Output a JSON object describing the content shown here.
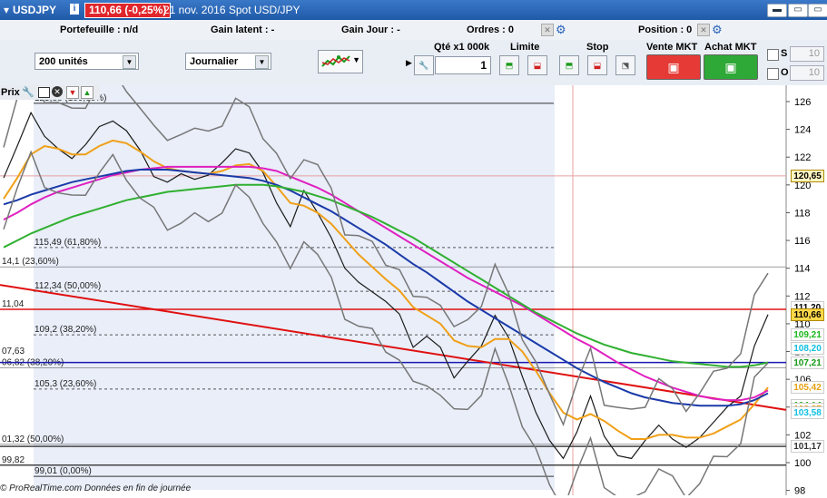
{
  "title_bar": {
    "symbol": "USDJPY",
    "info_icon": "i",
    "price_change": "110,66 (-0,25%)",
    "date_desc": "21 nov. 2016 Spot USD/JPY"
  },
  "info_bar": {
    "portefeuille": "Portefeuille : n/d",
    "gain_latent": "Gain latent : -",
    "gain_jour": "Gain Jour : -",
    "ordres": "Ordres : 0",
    "position": "Position : 0"
  },
  "toolbar": {
    "units_select": "200 unités",
    "period_select": "Journalier",
    "qty_label": "Qté x1 000k",
    "qty_value": "1",
    "limite_label": "Limite",
    "stop_label": "Stop",
    "vente_label": "Vente MKT",
    "achat_label": "Achat MKT",
    "box1": "10",
    "box2": "10"
  },
  "chart_toolbar": {
    "label": "Prix"
  },
  "chart_data": {
    "type": "line",
    "title": "USDJPY",
    "y_axis_ticks": [
      "126",
      "124",
      "122",
      "120",
      "118",
      "116",
      "114",
      "112",
      "110",
      "108",
      "106",
      "104",
      "102",
      "100",
      "98"
    ],
    "ylim": [
      98,
      127
    ],
    "price_tags": [
      {
        "value": "120,65",
        "bg": "#fff6c2",
        "fg": "#000"
      },
      {
        "value": "111,20",
        "bg": "#ffffff",
        "fg": "#000"
      },
      {
        "value": "110,66",
        "bg": "#ffd84a",
        "fg": "#000"
      },
      {
        "value": "109,21",
        "bg": "#ffffff",
        "fg": "#18b818"
      },
      {
        "value": "108,20",
        "bg": "#ffffff",
        "fg": "#10c0e0"
      },
      {
        "value": "107,21",
        "bg": "#ffffff",
        "fg": "#149a14"
      },
      {
        "value": "105,42",
        "bg": "#ffffff",
        "fg": "#e6a010"
      },
      {
        "value": "104,14",
        "bg": "#ffffff",
        "fg": "#18b818"
      },
      {
        "value": "103,87",
        "bg": "#ffffff",
        "fg": "#e6a010"
      },
      {
        "value": "103,58",
        "bg": "#ffffff",
        "fg": "#10c0e0"
      },
      {
        "value": "101,17",
        "bg": "#ffffff",
        "fg": "#333333"
      }
    ],
    "fibonacci_levels_left": [
      {
        "label": "125,88 (100,00%)",
        "price": 125.88
      },
      {
        "label": "115,49 (61,80%)",
        "price": 115.49
      },
      {
        "label": "112,34 (50,00%)",
        "price": 112.34
      },
      {
        "label": "109,2 (38,20%)",
        "price": 109.2
      },
      {
        "label": "105,3 (23,60%)",
        "price": 105.3
      },
      {
        "label": "99,01 (0,00%)",
        "price": 99.01
      }
    ],
    "fibonacci_levels_edge": [
      {
        "label": "14,1 (23,60%)",
        "price": 114.1
      },
      {
        "label": "06,82 (38,20%)",
        "price": 106.82
      },
      {
        "label": "01,32 (50,00%)",
        "price": 101.32
      }
    ],
    "edge_labels": [
      {
        "label": "11,04",
        "price": 111.04
      },
      {
        "label": "07,63",
        "price": 107.63
      },
      {
        "label": "99,82",
        "price": 99.82
      }
    ],
    "horizontal_lines": [
      {
        "price": 111.04,
        "color": "#e01010"
      },
      {
        "price": 107.21,
        "color": "#1a1ab0"
      },
      {
        "price": 101.17,
        "color": "#444444"
      },
      {
        "price": 99.82,
        "color": "#444444"
      }
    ],
    "trendline": {
      "from": 112.8,
      "to": 103.8,
      "color": "#e01010"
    },
    "series": [
      {
        "name": "price",
        "color": "#1b1b1b",
        "values": [
          120.5,
          122.8,
          125.2,
          123.5,
          122.6,
          121.9,
          122.9,
          124.2,
          124.6,
          123.9,
          122.5,
          120.6,
          120.2,
          120.8,
          120.4,
          120.7,
          121.6,
          122.6,
          122.3,
          120.9,
          118.7,
          117.0,
          119.6,
          118.0,
          116.2,
          114.0,
          113.0,
          112.3,
          111.6,
          110.7,
          108.3,
          109.1,
          108.3,
          106.1,
          107.3,
          108.4,
          110.6,
          109.0,
          106.2,
          103.6,
          101.6,
          100.3,
          102.2,
          104.8,
          101.9,
          100.5,
          100.3,
          101.6,
          102.7,
          101.7,
          101.1,
          101.8,
          102.9,
          104.0,
          104.8,
          108.4,
          110.66
        ]
      },
      {
        "name": "ma-orange",
        "color": "#f0a018",
        "values": [
          119.0,
          120.5,
          122.2,
          122.8,
          122.6,
          122.2,
          122.2,
          122.8,
          123.2,
          123.0,
          122.4,
          121.7,
          121.2,
          121.0,
          120.9,
          120.8,
          121.0,
          121.4,
          121.5,
          121.0,
          119.9,
          118.7,
          118.5,
          118.0,
          117.2,
          116.1,
          115.0,
          114.1,
          113.2,
          112.4,
          111.2,
          110.6,
          110.0,
          108.8,
          108.4,
          108.3,
          108.9,
          108.9,
          108.0,
          106.6,
          105.0,
          103.6,
          103.1,
          103.5,
          103.0,
          102.3,
          101.7,
          101.7,
          102.0,
          102.0,
          101.8,
          101.8,
          102.1,
          102.6,
          103.1,
          104.2,
          105.42
        ]
      },
      {
        "name": "ma-magenta",
        "color": "#e020c0",
        "values": [
          117.5,
          118.0,
          118.6,
          119.1,
          119.5,
          119.8,
          120.1,
          120.4,
          120.7,
          120.9,
          121.1,
          121.2,
          121.3,
          121.3,
          121.3,
          121.3,
          121.3,
          121.3,
          121.3,
          121.2,
          121.0,
          120.6,
          120.2,
          119.8,
          119.3,
          118.7,
          118.1,
          117.5,
          116.9,
          116.3,
          115.7,
          115.1,
          114.5,
          113.9,
          113.3,
          112.8,
          112.3,
          111.8,
          111.3,
          110.7,
          110.1,
          109.5,
          108.9,
          108.4,
          107.8,
          107.2,
          106.7,
          106.2,
          105.8,
          105.4,
          105.1,
          104.8,
          104.6,
          104.5,
          104.5,
          104.7,
          105.2
        ]
      },
      {
        "name": "ma-blue",
        "color": "#1a3aa8",
        "values": [
          118.6,
          118.9,
          119.3,
          119.6,
          119.9,
          120.2,
          120.4,
          120.6,
          120.8,
          121.0,
          121.1,
          121.1,
          121.1,
          121.0,
          120.9,
          120.8,
          120.7,
          120.6,
          120.5,
          120.3,
          120.0,
          119.6,
          119.1,
          118.6,
          118.1,
          117.5,
          116.9,
          116.3,
          115.7,
          115.0,
          114.3,
          113.7,
          113.0,
          112.3,
          111.6,
          111.0,
          110.4,
          109.8,
          109.2,
          108.6,
          108.0,
          107.4,
          106.8,
          106.3,
          105.8,
          105.4,
          105.0,
          104.7,
          104.5,
          104.3,
          104.2,
          104.1,
          104.1,
          104.1,
          104.2,
          104.5,
          105.0
        ]
      },
      {
        "name": "ma-green",
        "color": "#30b030",
        "values": [
          115.5,
          116.0,
          116.5,
          116.9,
          117.3,
          117.7,
          118.0,
          118.3,
          118.6,
          118.9,
          119.1,
          119.3,
          119.5,
          119.6,
          119.7,
          119.8,
          119.9,
          120.0,
          120.0,
          120.0,
          119.9,
          119.7,
          119.5,
          119.2,
          118.9,
          118.5,
          118.1,
          117.7,
          117.2,
          116.7,
          116.2,
          115.6,
          115.0,
          114.4,
          113.8,
          113.2,
          112.6,
          112.0,
          111.4,
          110.8,
          110.3,
          109.8,
          109.3,
          108.9,
          108.5,
          108.2,
          107.9,
          107.7,
          107.5,
          107.3,
          107.2,
          107.1,
          107.0,
          106.9,
          106.9,
          107.0,
          107.21
        ]
      }
    ]
  },
  "footer": {
    "text": "© ProRealTime.com  Données en fin de journée"
  }
}
